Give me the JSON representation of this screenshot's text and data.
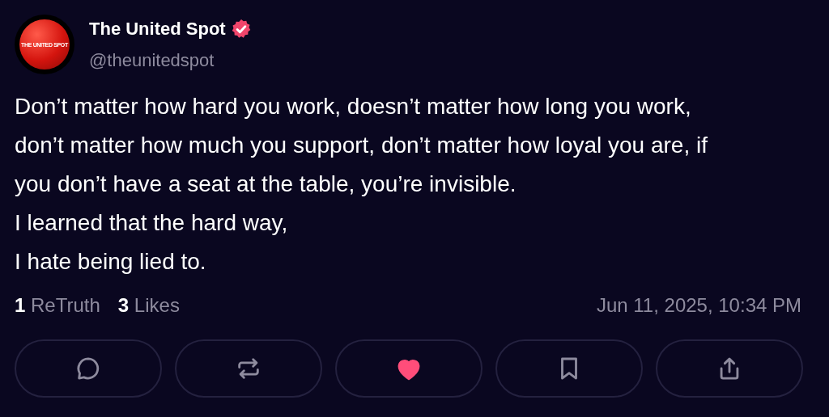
{
  "author": {
    "name": "The United Spot",
    "handle": "@theunitedspot",
    "verified": true,
    "avatar_text": "THE UNITED SPOT"
  },
  "body": "Don’t matter how hard you work, doesn’t matter how long you work, don’t matter how much you support, don’t matter how loyal you are, if you don’t have a seat at the table, you’re invisible.\nI learned that the hard way,\nI hate being lied to.",
  "stats": [
    {
      "count": "1",
      "label": "ReTruth"
    },
    {
      "count": "3",
      "label": "Likes"
    }
  ],
  "timestamp": "Jun 11, 2025, 10:34 PM",
  "actions": [
    {
      "kind": "reply",
      "on": false
    },
    {
      "kind": "retruth",
      "on": false
    },
    {
      "kind": "like",
      "on": true
    },
    {
      "kind": "bookmark",
      "on": false
    },
    {
      "kind": "share",
      "on": false
    }
  ]
}
